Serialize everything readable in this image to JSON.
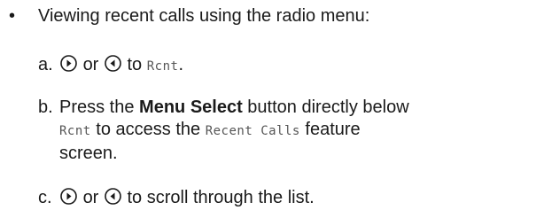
{
  "bullet": {
    "marker": "•",
    "text": "Viewing recent calls using the radio menu:"
  },
  "steps": [
    {
      "letter": "a.",
      "or": "or",
      "to": "to",
      "code": "Rcnt",
      "tail": "."
    },
    {
      "letter": "b.",
      "lead": "Press the ",
      "bold": "Menu Select",
      "after_bold": " button directly below",
      "code1": "Rcnt",
      "mid": " to access the ",
      "code2": "Recent Calls",
      "after_code2": " feature",
      "end": "screen."
    },
    {
      "letter": "c.",
      "or": "or",
      "text": "to scroll through the list."
    }
  ],
  "icons": {
    "right": "nav-right-button-icon",
    "left": "nav-left-button-icon"
  }
}
